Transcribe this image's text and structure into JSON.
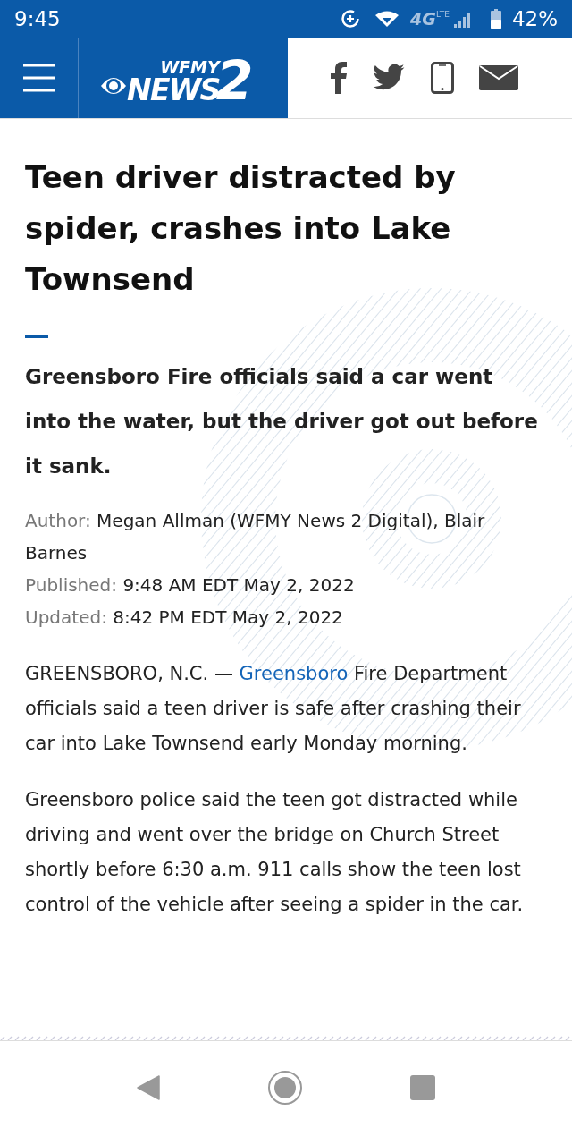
{
  "status_bar": {
    "time": "9:45",
    "network": "4G",
    "network_sub": "LTE",
    "battery": "42%"
  },
  "header": {
    "logo": {
      "station": "WFMY",
      "brand": "NEWS",
      "channel": "2"
    }
  },
  "article": {
    "title": "Teen driver distracted by spider, crashes into Lake Townsend",
    "subtitle": "Greensboro Fire officials said a car went into the water, but the driver got out before it sank.",
    "meta": [
      {
        "label": "Author:",
        "value": "Megan Allman (WFMY News 2 Digital), Blair Barnes"
      },
      {
        "label": "Published:",
        "value": "9:48 AM EDT May 2, 2022"
      },
      {
        "label": "Updated:",
        "value": "8:42 PM EDT May 2, 2022"
      }
    ],
    "paragraphs": [
      {
        "parts": [
          {
            "kind": "text",
            "text": "GREENSBORO, N.C. — "
          },
          {
            "kind": "link",
            "text": "Greensboro"
          },
          {
            "kind": "text",
            "text": " Fire Department officials said a teen driver is safe after crashing their car into Lake Townsend early Monday morning."
          }
        ]
      },
      {
        "parts": [
          {
            "kind": "text",
            "text": "Greensboro police said the teen got distracted while driving and went over the bridge on Church Street shortly before 6:30 a.m. 911 calls show the teen lost control of the vehicle after seeing a spider in the car."
          }
        ]
      }
    ]
  }
}
